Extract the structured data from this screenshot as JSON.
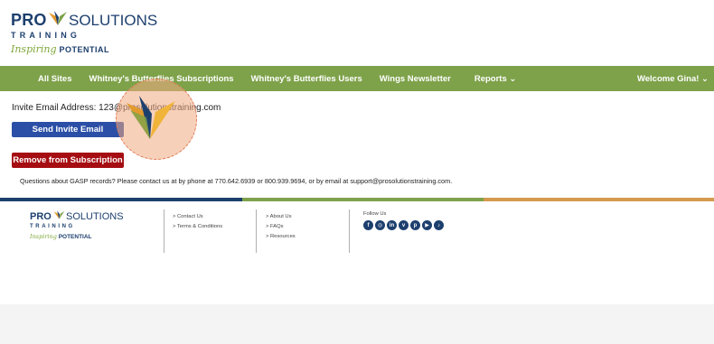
{
  "header": {
    "logo": {
      "brand": "PRO",
      "solutions": "SOLUTIONS",
      "training": "TRAINING",
      "tagline_script": "Inspiring",
      "tagline_word": "POTENTIAL"
    }
  },
  "nav": {
    "items": [
      {
        "label": "All Sites"
      },
      {
        "label": "Whitney's Butterflies Subscriptions"
      },
      {
        "label": "Whitney's Butterflies Users"
      },
      {
        "label": "Wings Newsletter"
      },
      {
        "label": "Reports ⌄"
      }
    ],
    "welcome": "Welcome Gina! ⌄"
  },
  "main": {
    "invite_label": "Invite Email Address: 123@prosolutionstraining.com",
    "send_button": "Send Invite Email",
    "remove_button": "Remove from Subscription",
    "questions": "Questions about GASP records? Please contact us at by phone at 770.642.6939 or 800.939.9694, or by email at support@prosolutionstraining.com."
  },
  "footer": {
    "logo": {
      "brand": "PRO",
      "solutions": "SOLUTIONS",
      "training": "TRAINING",
      "tagline_script": "Inspiring",
      "tagline_word": "POTENTIAL"
    },
    "col1": [
      "> Contact Us",
      "> Terms & Conditions"
    ],
    "col2": [
      "> About Us",
      "> FAQs",
      "> Resources"
    ],
    "follow_title": "Follow Us",
    "social": [
      {
        "icon": "facebook-icon",
        "glyph": "f"
      },
      {
        "icon": "instagram-icon",
        "glyph": "◎"
      },
      {
        "icon": "linkedin-icon",
        "glyph": "in"
      },
      {
        "icon": "vimeo-icon",
        "glyph": "v"
      },
      {
        "icon": "pinterest-icon",
        "glyph": "p"
      },
      {
        "icon": "youtube-icon",
        "glyph": "▶"
      },
      {
        "icon": "tiktok-icon",
        "glyph": "♪"
      }
    ]
  },
  "colors": {
    "nav_green": "#7ea24a",
    "brand_navy": "#1d3f6e",
    "send_blue": "#2b4fa6",
    "remove_red": "#a50d12",
    "stripe_orange": "#d49a4e"
  }
}
